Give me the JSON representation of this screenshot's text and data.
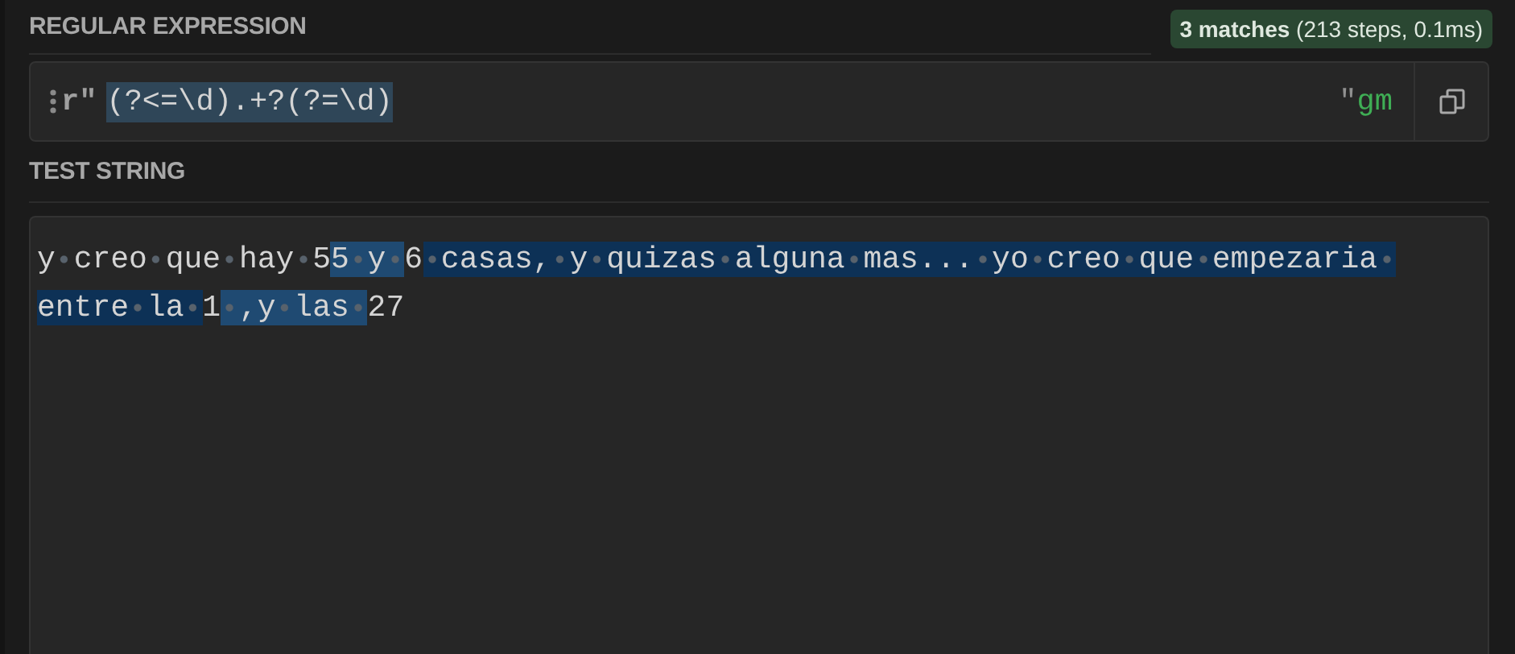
{
  "regex_section": {
    "title": "REGULAR EXPRESSION",
    "match_info": "**3 matches** (213 steps, 0.1ms)"
  },
  "regex_field": {
    "prefix": "r\"",
    "pattern": "(?<=\\d).+?(?=\\d)",
    "selected": true,
    "suffix": "\"",
    "flags": "gm"
  },
  "test_section": {
    "title": "TEST STRING"
  },
  "test_string": {
    "segments": [
      {
        "text": "y creo que hay 5",
        "match": false
      },
      {
        "text": "5 y ",
        "match": true
      },
      {
        "text": "6",
        "match": false
      },
      {
        "text": " casas, y quizas alguna mas... yo creo que empezaria entre la ",
        "match": true
      },
      {
        "text": "1",
        "match": false
      },
      {
        "text": " ,y las ",
        "match": true
      },
      {
        "text": "27",
        "match": false
      }
    ]
  }
}
